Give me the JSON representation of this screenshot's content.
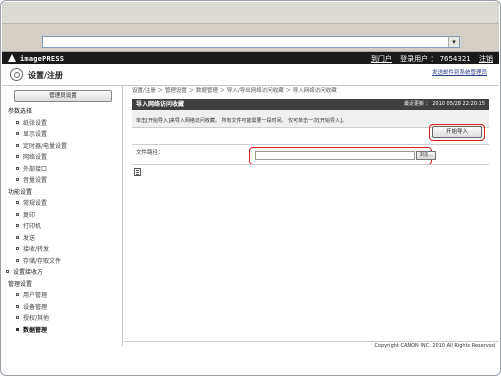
{
  "browser": {
    "address_value": ""
  },
  "header": {
    "product": "imagePRESS",
    "portal_link": "到门户",
    "user_label": "登录用户 ： 7654321",
    "logout_link": "注销"
  },
  "subheader": {
    "title": "设置/注册",
    "mail_link": "发送邮件到系统管理员"
  },
  "sidebar": {
    "manage_button": "管理员设置",
    "groups": [
      {
        "label": "参数选择",
        "items": [
          "纸张设置",
          "显示设置",
          "定时器/电量设置",
          "网络设置",
          "外部接口",
          "音量设置"
        ]
      },
      {
        "label": "功能设置",
        "items": [
          "常规设置",
          "复印",
          "打印机",
          "发送",
          "接收/转发",
          "存储/存取文件"
        ]
      },
      {
        "label": "设置接收方",
        "items": []
      },
      {
        "label": "管理设置",
        "items": [
          "用户管理",
          "设备管理",
          "授权/其他",
          "数据管理"
        ]
      }
    ]
  },
  "main": {
    "breadcrumb": "设置/注册 ＞ 管理设置 ＞ 数据管理 ＞ 导入/导出网络访问收藏 ＞ 导入网络访问收藏",
    "panel_title": "导入网络访问收藏",
    "last_updated": "最近更新 ： 2010 05/28 22:20:15",
    "message": "单击[开始导入]来导入网络访问收藏。 所有文件可能需要一段时间。 仅可单击一次[开始导入]。",
    "start_button": "开始导入",
    "path_label": "文件路径：",
    "path_value": "",
    "browse_button": "浏览..."
  },
  "footer": {
    "copyright": "Copyright CANON INC. 2010 All Rights Reserved"
  }
}
